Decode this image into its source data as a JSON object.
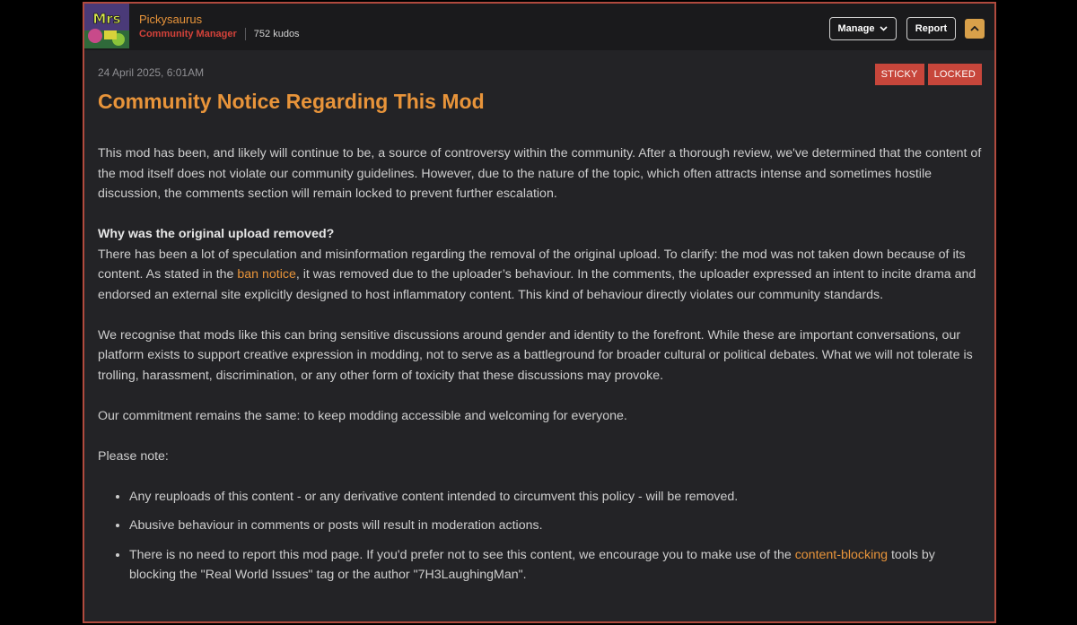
{
  "post": {
    "username": "Pickysaurus",
    "role": "Community Manager",
    "kudos": "752 kudos",
    "avatar_text": "Mrs",
    "date": "24 April 2025, 6:01AM",
    "badges": [
      "STICKY",
      "LOCKED"
    ],
    "title": "Community Notice Regarding This Mod"
  },
  "toolbar": {
    "manage_label": "Manage",
    "report_label": "Report"
  },
  "icons": {
    "manage_chevron": "chevron-down-icon",
    "collapse": "chevron-up-icon"
  },
  "colors": {
    "accent": "#e8943a",
    "role": "#d4423a",
    "badge": "#c7463b",
    "border": "#b04a3e"
  },
  "body": {
    "p1": "This mod has been, and likely will continue to be, a source of controversy within the community. After a thorough review, we've determined that the content of the mod itself does not violate our community guidelines. However, due to the nature of the topic, which often attracts intense and sometimes hostile discussion, the comments section will remain locked to prevent further escalation.",
    "heading": "Why was the original upload removed?",
    "p2_before": "There has been a lot of speculation and misinformation regarding the removal of the original upload. To clarify: the mod was not taken down because of its content. As stated in the ",
    "p2_link": "ban notice",
    "p2_after": ", it was removed due to the uploader’s behaviour. In the comments, the uploader expressed an intent to incite drama and endorsed an external site explicitly designed to host inflammatory content. This kind of behaviour directly violates our community standards.",
    "p3": "We recognise that mods like this can bring sensitive discussions around gender and identity to the forefront. While these are important conversations, our platform exists to support creative expression in modding, not to serve as a battleground for broader cultural or political debates. What we will not tolerate is trolling, harassment, discrimination, or any other form of toxicity that these discussions may provoke.",
    "p4": "Our commitment remains the same: to keep modding accessible and welcoming for everyone.",
    "p5": "Please note:",
    "li1": "Any reuploads of this content - or any derivative content intended to circumvent this policy - will be removed.",
    "li2": "Abusive behaviour in comments or posts will result in moderation actions.",
    "li3_before": "There is no need to report this mod page. If you'd prefer not to see this content, we encourage you to make use of the ",
    "li3_link": "content-blocking",
    "li3_after": " tools by blocking the \"Real World Issues\" tag or the author \"7H3LaughingMan\"."
  }
}
